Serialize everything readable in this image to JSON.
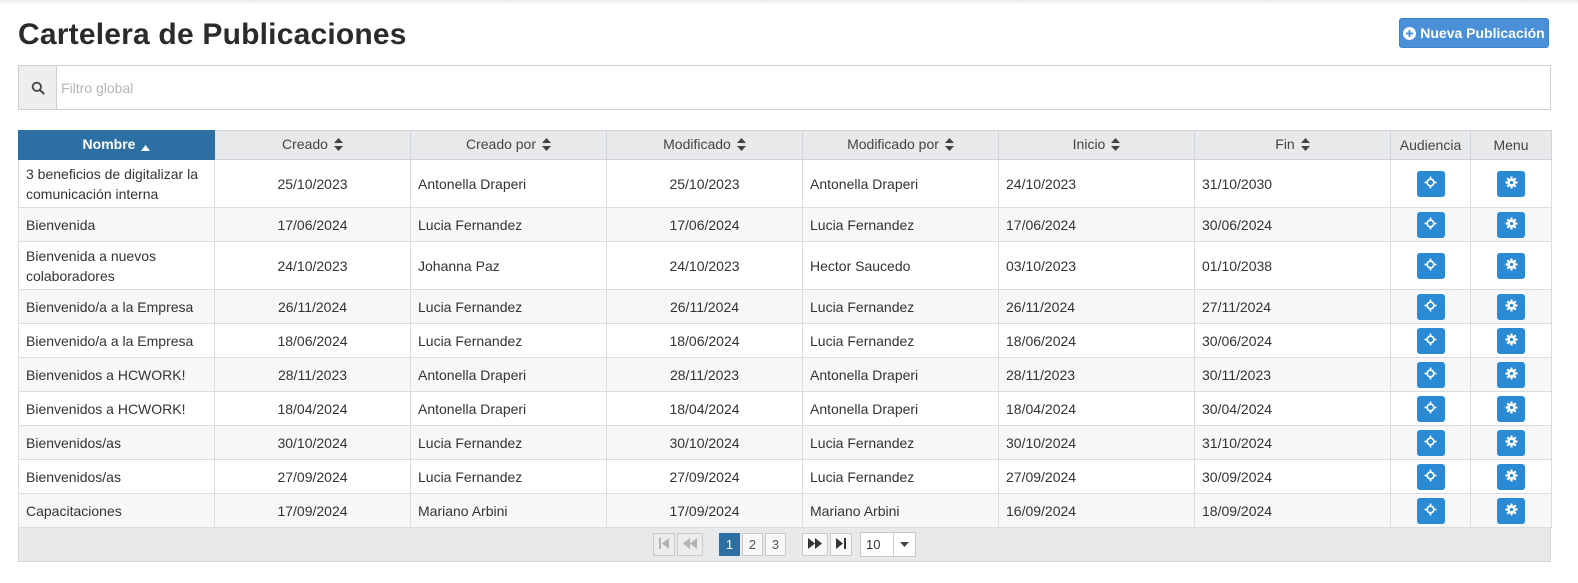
{
  "page": {
    "title": "Cartelera de Publicaciones",
    "new_button_label": "Nueva Publicación"
  },
  "filter": {
    "placeholder": "Filtro global",
    "value": ""
  },
  "table": {
    "columns": {
      "nombre": "Nombre",
      "creado": "Creado",
      "creado_por": "Creado por",
      "modificado": "Modificado",
      "modificado_por": "Modificado por",
      "inicio": "Inicio",
      "fin": "Fin",
      "audiencia": "Audiencia",
      "menu": "Menu"
    },
    "sorted_column": "Nombre",
    "sort_direction": "ascending",
    "rows": [
      {
        "nombre": "3 beneficios de digitalizar la comunicación interna",
        "creado": "25/10/2023",
        "creado_por": "Antonella Draperi",
        "modificado": "25/10/2023",
        "modificado_por": "Antonella Draperi",
        "inicio": "24/10/2023",
        "fin": "31/10/2030"
      },
      {
        "nombre": "Bienvenida",
        "creado": "17/06/2024",
        "creado_por": "Lucia Fernandez",
        "modificado": "17/06/2024",
        "modificado_por": "Lucia Fernandez",
        "inicio": "17/06/2024",
        "fin": "30/06/2024"
      },
      {
        "nombre": "Bienvenida a nuevos colaboradores",
        "creado": "24/10/2023",
        "creado_por": "Johanna Paz",
        "modificado": "24/10/2023",
        "modificado_por": "Hector Saucedo",
        "inicio": "03/10/2023",
        "fin": "01/10/2038"
      },
      {
        "nombre": "Bienvenido/a a la Empresa",
        "creado": "26/11/2024",
        "creado_por": "Lucia Fernandez",
        "modificado": "26/11/2024",
        "modificado_por": "Lucia Fernandez",
        "inicio": "26/11/2024",
        "fin": "27/11/2024"
      },
      {
        "nombre": "Bienvenido/a a la Empresa",
        "creado": "18/06/2024",
        "creado_por": "Lucia Fernandez",
        "modificado": "18/06/2024",
        "modificado_por": "Lucia Fernandez",
        "inicio": "18/06/2024",
        "fin": "30/06/2024"
      },
      {
        "nombre": "Bienvenidos a HCWORK!",
        "creado": "28/11/2023",
        "creado_por": "Antonella Draperi",
        "modificado": "28/11/2023",
        "modificado_por": "Antonella Draperi",
        "inicio": "28/11/2023",
        "fin": "30/11/2023"
      },
      {
        "nombre": "Bienvenidos a HCWORK!",
        "creado": "18/04/2024",
        "creado_por": "Antonella Draperi",
        "modificado": "18/04/2024",
        "modificado_por": "Antonella Draperi",
        "inicio": "18/04/2024",
        "fin": "30/04/2024"
      },
      {
        "nombre": "Bienvenidos/as",
        "creado": "30/10/2024",
        "creado_por": "Lucia Fernandez",
        "modificado": "30/10/2024",
        "modificado_por": "Lucia Fernandez",
        "inicio": "30/10/2024",
        "fin": "31/10/2024"
      },
      {
        "nombre": "Bienvenidos/as",
        "creado": "27/09/2024",
        "creado_por": "Lucia Fernandez",
        "modificado": "27/09/2024",
        "modificado_por": "Lucia Fernandez",
        "inicio": "27/09/2024",
        "fin": "30/09/2024"
      },
      {
        "nombre": "Capacitaciones",
        "creado": "17/09/2024",
        "creado_por": "Mariano Arbini",
        "modificado": "17/09/2024",
        "modificado_por": "Mariano Arbini",
        "inicio": "16/09/2024",
        "fin": "18/09/2024"
      }
    ]
  },
  "pagination": {
    "pages": [
      "1",
      "2",
      "3"
    ],
    "current_page": "1",
    "page_size": "10"
  },
  "icons": {
    "search": "search-icon",
    "new": "plus-circle-icon",
    "audiencia": "crosshairs-icon",
    "menu": "gear-icon"
  },
  "colors": {
    "accent": "#2e6fa3",
    "action_button": "#2b8ad4",
    "new_button": "#4a90d9"
  }
}
